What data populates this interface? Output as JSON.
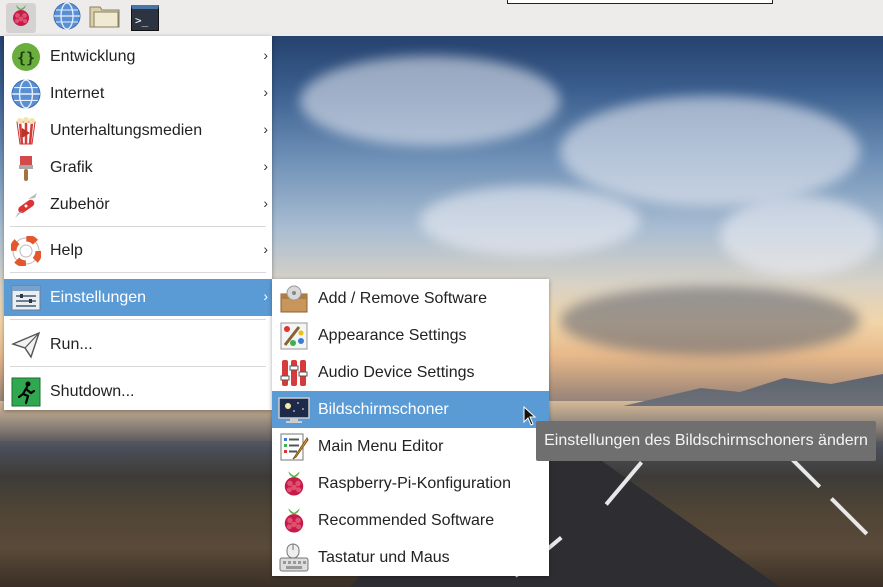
{
  "panel": {
    "buttons": [
      {
        "icon": "raspberry-icon"
      },
      {
        "icon": "globe-icon"
      },
      {
        "icon": "folder-icon"
      },
      {
        "icon": "terminal-icon",
        "glyph": ">_"
      }
    ]
  },
  "main_menu": {
    "items": [
      {
        "label": "Entwicklung",
        "icon": "code-braces-icon",
        "has_submenu": true
      },
      {
        "label": "Internet",
        "icon": "globe-icon",
        "has_submenu": true
      },
      {
        "label": "Unterhaltungsmedien",
        "icon": "popcorn-icon",
        "has_submenu": true
      },
      {
        "label": "Grafik",
        "icon": "paintbrush-icon",
        "has_submenu": true
      },
      {
        "label": "Zubehör",
        "icon": "pocketknife-icon",
        "has_submenu": true
      },
      {
        "label": "Help",
        "icon": "lifebuoy-icon",
        "has_submenu": true
      },
      {
        "label": "Einstellungen",
        "icon": "settings-panel-icon",
        "has_submenu": true,
        "selected": true
      },
      {
        "label": "Run...",
        "icon": "paper-plane-icon",
        "has_submenu": false
      },
      {
        "label": "Shutdown...",
        "icon": "exit-icon",
        "has_submenu": false
      }
    ]
  },
  "submenu": {
    "items": [
      {
        "label": "Add / Remove Software",
        "icon": "package-icon"
      },
      {
        "label": "Appearance Settings",
        "icon": "palette-icon"
      },
      {
        "label": "Audio Device Settings",
        "icon": "mixer-sliders-icon"
      },
      {
        "label": "Bildschirmschoner",
        "icon": "monitor-icon",
        "selected": true
      },
      {
        "label": "Main Menu Editor",
        "icon": "menu-edit-icon"
      },
      {
        "label": "Raspberry-Pi-Konfiguration",
        "icon": "raspberry-icon"
      },
      {
        "label": "Recommended Software",
        "icon": "raspberry-icon"
      },
      {
        "label": "Tastatur und Maus",
        "icon": "keyboard-mouse-icon"
      }
    ]
  },
  "tooltip": {
    "text": "Einstellungen des Bildschirmschoners ändern"
  },
  "colors": {
    "selection": "#5b9bd5",
    "panel": "#edecea",
    "tooltip": "#6f6f6f"
  }
}
